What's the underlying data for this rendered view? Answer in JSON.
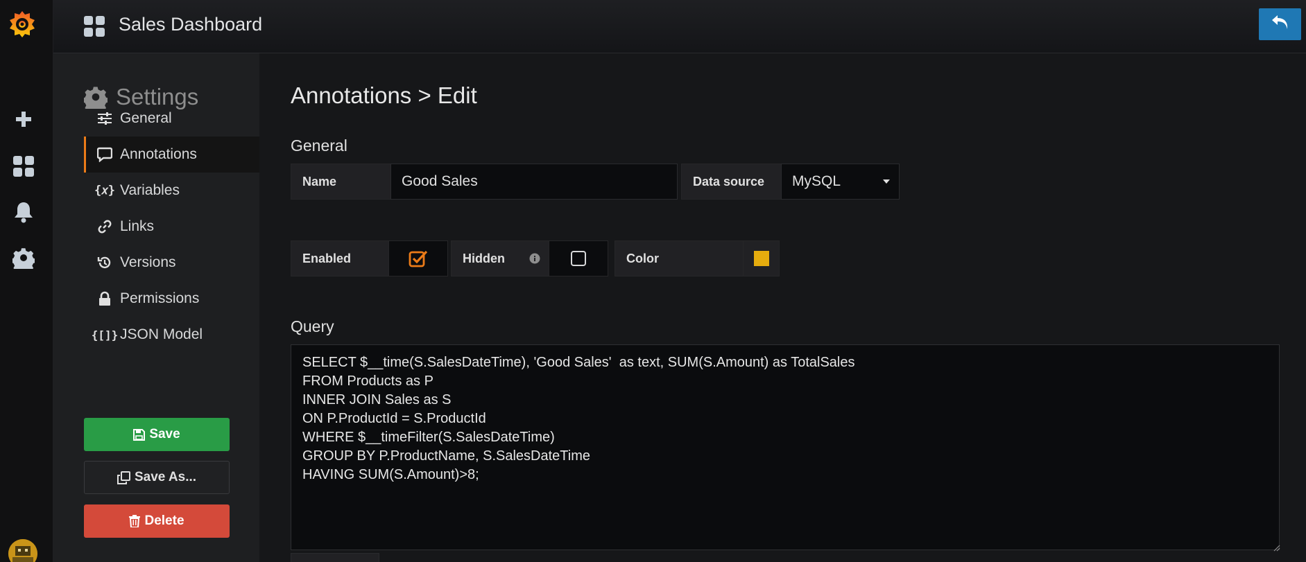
{
  "app": {
    "title": "Sales Dashboard"
  },
  "rail": {
    "icons": [
      "grafana-logo-icon",
      "plus-icon",
      "dashboards-icon",
      "bell-icon",
      "gear-icon",
      "user-avatar"
    ]
  },
  "settings": {
    "heading": "Settings",
    "items": [
      {
        "label": "General",
        "icon": "sliders-icon"
      },
      {
        "label": "Annotations",
        "icon": "comment-icon"
      },
      {
        "label": "Variables",
        "icon": "variable-icon"
      },
      {
        "label": "Links",
        "icon": "link-icon"
      },
      {
        "label": "Versions",
        "icon": "history-icon"
      },
      {
        "label": "Permissions",
        "icon": "lock-icon"
      },
      {
        "label": "JSON Model",
        "icon": "json-icon"
      }
    ],
    "active_item": "Annotations",
    "buttons": {
      "save": "Save",
      "save_as": "Save As...",
      "delete": "Delete"
    }
  },
  "main": {
    "title": "Annotations > Edit",
    "general": {
      "heading": "General",
      "name_label": "Name",
      "name_value": "Good Sales",
      "datasource_label": "Data source",
      "datasource_value": "MySQL"
    },
    "options": {
      "enabled_label": "Enabled",
      "enabled": true,
      "hidden_label": "Hidden",
      "hidden": false,
      "color_label": "Color",
      "color_value": "#e5ac0e"
    },
    "query": {
      "heading": "Query",
      "text": "SELECT $__time(S.SalesDateTime), 'Good Sales'  as text, SUM(S.Amount) as TotalSales\nFROM Products as P\nINNER JOIN Sales as S\nON P.ProductId = S.ProductId\nWHERE $__timeFilter(S.SalesDateTime)\nGROUP BY P.ProductName, S.SalesDateTime\nHAVING SUM(S.Amount)>8;"
    }
  },
  "colors": {
    "accent_orange": "#eb7b18",
    "save_green": "#299c46",
    "delete_red": "#d44a3a",
    "back_blue": "#1f78b4"
  }
}
